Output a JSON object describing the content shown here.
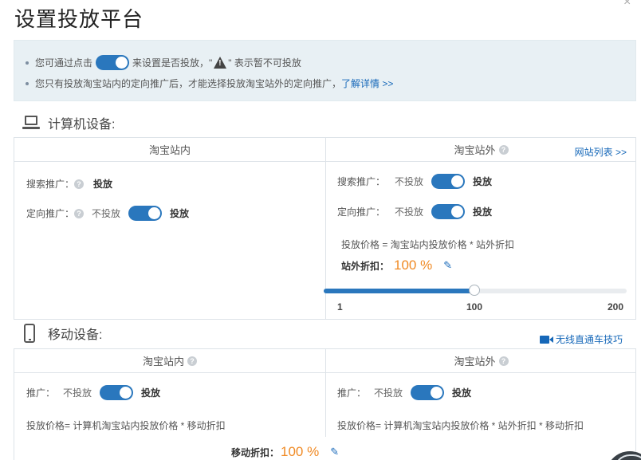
{
  "dialog": {
    "title": "设置投放平台",
    "close_icon": "×"
  },
  "notice": {
    "line1_prefix": "您可通过点击",
    "line1_middle": "来设置是否投放，\"",
    "line1_suffix": "\" 表示暂不可投放",
    "line2_text": "您只有投放淘宝站内的定向推广后，才能选择投放淘宝站外的定向推广，",
    "line2_link": "了解详情 >>"
  },
  "pc_section": {
    "title": "计算机设备:",
    "left_header": "淘宝站内",
    "right_header": "淘宝站外",
    "right_header_link": "网站列表 >>",
    "left_rows": [
      {
        "label": "搜索推广：",
        "state": "投放"
      },
      {
        "label": "定向推广：",
        "off_label": "不投放",
        "state": "投放"
      }
    ],
    "right_rows": [
      {
        "label": "搜索推广：",
        "off_label": "不投放",
        "state": "投放"
      },
      {
        "label": "定向推广：",
        "off_label": "不投放",
        "state": "投放"
      }
    ],
    "price_formula": "投放价格 = 淘宝站内投放价格 * 站外折扣",
    "discount_label": "站外折扣：",
    "discount_value": "100 %",
    "slider": {
      "min": "1",
      "mid": "100",
      "max": "200",
      "value": 100,
      "min_value": 1,
      "max_value": 200
    }
  },
  "mobile_section": {
    "title": "移动设备:",
    "tips_link": "无线直通车技巧",
    "left_header": "淘宝站内",
    "right_header": "淘宝站外",
    "left_row": {
      "label": "推广：",
      "off_label": "不投放",
      "state": "投放"
    },
    "right_row": {
      "label": "推广：",
      "off_label": "不投放",
      "state": "投放"
    },
    "left_formula": "投放价格= 计算机淘宝站内投放价格 * 移动折扣",
    "right_formula": "投放价格= 计算机淘宝站内投放价格 * 站外折扣 * 移动折扣",
    "discount_label": "移动折扣：",
    "discount_value": "100 %"
  },
  "colors": {
    "accent": "#2a77bd",
    "orange": "#f08a24",
    "notice_bg": "#e8f0f4",
    "link": "#1668b9"
  }
}
